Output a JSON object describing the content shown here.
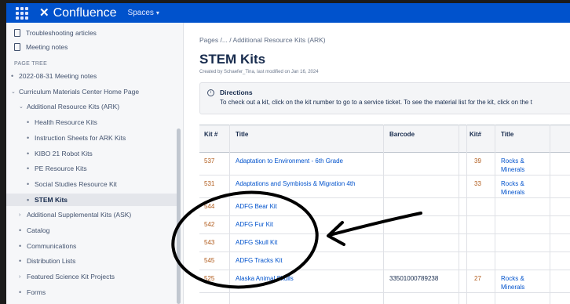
{
  "header": {
    "app_name": "Confluence",
    "spaces_label": "Spaces",
    "icons": [
      "app-grid-icon",
      "confluence-logo-icon",
      "chevron-down-icon"
    ]
  },
  "sidebar": {
    "top_links": [
      "Troubleshooting articles",
      "Meeting notes"
    ],
    "page_tree_heading": "PAGE TREE",
    "tree": [
      {
        "label": "2022-08-31 Meeting notes",
        "marker": "•",
        "indent": 0
      },
      {
        "label": "Curriculum Materials Center Home Page",
        "marker": "⌄",
        "indent": 0
      },
      {
        "label": "Additional Resource Kits (ARK)",
        "marker": "⌄",
        "indent": 1
      },
      {
        "label": "Health Resource Kits",
        "marker": "•",
        "indent": 2
      },
      {
        "label": "Instruction Sheets for ARK Kits",
        "marker": "•",
        "indent": 2
      },
      {
        "label": "KIBO 21 Robot Kits",
        "marker": "•",
        "indent": 2
      },
      {
        "label": "PE Resource Kits",
        "marker": "•",
        "indent": 2
      },
      {
        "label": "Social Studies Resource Kit",
        "marker": "•",
        "indent": 2
      },
      {
        "label": "STEM Kits",
        "marker": "•",
        "indent": 2,
        "active": true
      },
      {
        "label": "Additional Supplemental Kits (ASK)",
        "marker": "›",
        "indent": 1
      },
      {
        "label": "Catalog",
        "marker": "•",
        "indent": 1
      },
      {
        "label": "Communications",
        "marker": "•",
        "indent": 1
      },
      {
        "label": "Distribution Lists",
        "marker": "•",
        "indent": 1
      },
      {
        "label": "Featured Science Kit Projects",
        "marker": "›",
        "indent": 1
      },
      {
        "label": "Forms",
        "marker": "•",
        "indent": 1
      }
    ]
  },
  "main": {
    "breadcrumb": "Pages /... / Additional Resource Kits (ARK)",
    "title": "STEM Kits",
    "byline": "Created by Schaefer_Tina, last modified on Jan 16, 2024",
    "panel": {
      "title": "Directions",
      "text": "To check out a kit, click on the kit number to go to a service ticket. To see the material list for the kit, click on the t"
    },
    "table": {
      "headers": [
        "Kit #",
        "Title",
        "Barcode",
        "Kit#",
        "Title"
      ],
      "rows": [
        {
          "kit": "537",
          "title": "Adaptation to Environment - 6th Grade",
          "barcode": "",
          "kit2": "39",
          "title2": "Rocks & Minerals"
        },
        {
          "kit": "531",
          "title": "Adaptations and Symbiosis & Migration 4th",
          "barcode": "",
          "kit2": "33",
          "title2": "Rocks & Minerals"
        },
        {
          "kit": "544",
          "title": "ADFG Bear Kit",
          "barcode": "",
          "kit2": "",
          "title2": ""
        },
        {
          "kit": "542",
          "title": "ADFG Fur Kit",
          "barcode": "",
          "kit2": "",
          "title2": ""
        },
        {
          "kit": "543",
          "title": "ADFG Skull Kit",
          "barcode": "",
          "kit2": "",
          "title2": ""
        },
        {
          "kit": "545",
          "title": "ADFG Tracks Kit",
          "barcode": "",
          "kit2": "",
          "title2": ""
        },
        {
          "kit": "525",
          "title": "Alaska Animal Skulls",
          "barcode": "33501000789238",
          "kit2": "27",
          "title2": "Rocks & Minerals"
        }
      ]
    }
  },
  "colors": {
    "topbar": "#0052cc",
    "kit_number": "#b05a1a",
    "link": "#0052cc",
    "annotation": "#000000"
  }
}
